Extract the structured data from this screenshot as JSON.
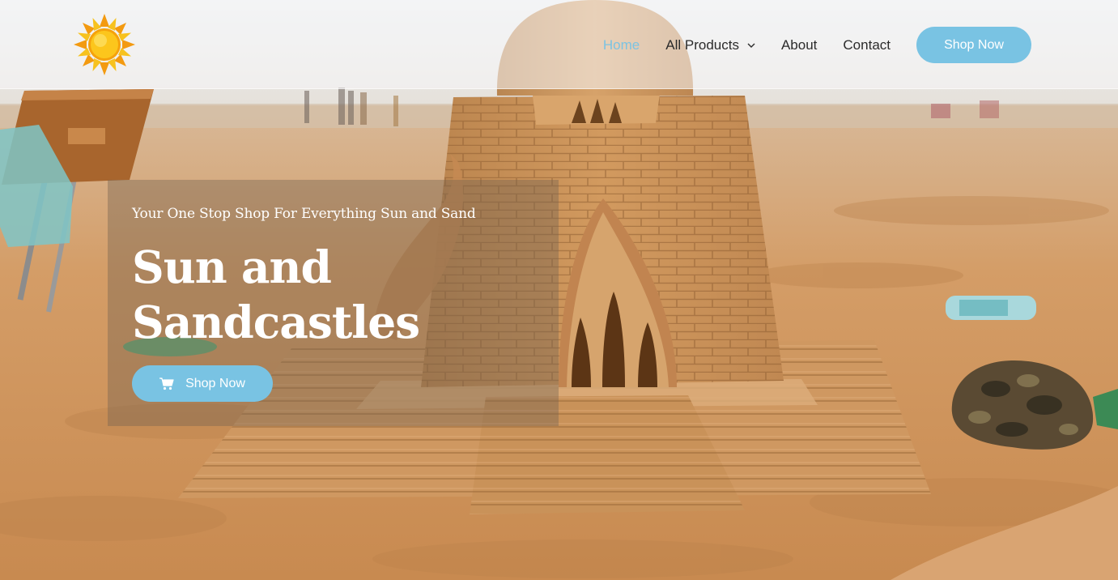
{
  "brand": {
    "logo_icon": "sun-icon"
  },
  "nav": {
    "items": [
      {
        "label": "Home",
        "active": true
      },
      {
        "label": "All Products",
        "has_dropdown": true
      },
      {
        "label": "About"
      },
      {
        "label": "Contact"
      }
    ],
    "cta_label": "Shop Now"
  },
  "hero": {
    "tagline": "Your One Stop Shop For Everything Sun and Sand",
    "title_line1": "Sun and",
    "title_line2": "Sandcastles",
    "button_label": "Shop Now",
    "button_icon": "shopping-cart-icon"
  },
  "colors": {
    "accent": "#79c3e3",
    "active_nav": "#7cc3e2",
    "text_dark": "#2b2b2b"
  }
}
